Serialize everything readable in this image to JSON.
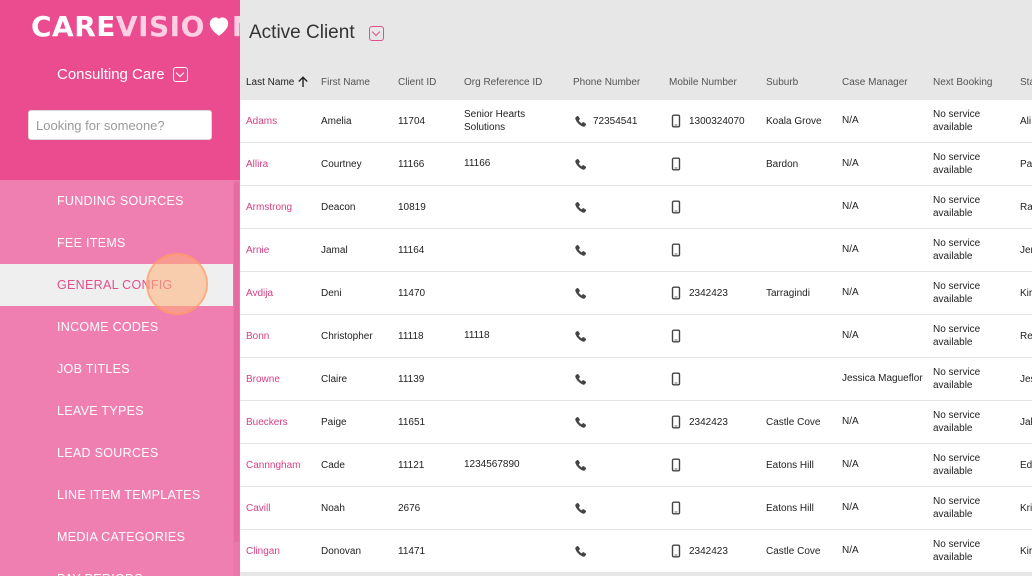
{
  "brand": {
    "care": "CARE",
    "vision": "VISIO",
    "n": "N",
    "accent": "#ea4c8f",
    "link_color": "#d63f83"
  },
  "org": {
    "name": "Consulting Care"
  },
  "search": {
    "placeholder": "Looking for someone?"
  },
  "nav": {
    "items": [
      {
        "label": "FUNDING SOURCES",
        "active": false
      },
      {
        "label": "FEE ITEMS",
        "active": false
      },
      {
        "label": "GENERAL CONFIG",
        "active": true
      },
      {
        "label": "INCOME CODES",
        "active": false
      },
      {
        "label": "JOB TITLES",
        "active": false
      },
      {
        "label": "LEAVE TYPES",
        "active": false
      },
      {
        "label": "LEAD SOURCES",
        "active": false
      },
      {
        "label": "LINE ITEM TEMPLATES",
        "active": false
      },
      {
        "label": "MEDIA CATEGORIES",
        "active": false
      },
      {
        "label": "PAY PERIODS",
        "active": false
      }
    ]
  },
  "main": {
    "title": "Active Client"
  },
  "table": {
    "columns": {
      "last": "Last Name",
      "first": "First Name",
      "id": "Client ID",
      "org": "Org Reference ID",
      "phone": "Phone Number",
      "mobile": "Mobile Number",
      "suburb": "Suburb",
      "cm": "Case Manager",
      "next": "Next Booking",
      "st": "Sta"
    },
    "rows": [
      {
        "last": "Adams",
        "first": "Amelia",
        "id": "11704",
        "org": "Senior Hearts Solutions",
        "phone": "72354541",
        "mobile": "1300324070",
        "suburb": "Koala Grove",
        "cm": "N/A",
        "next": "No service available",
        "st": "Ali"
      },
      {
        "last": "Allira",
        "first": "Courtney",
        "id": "11166",
        "org": "11166",
        "phone": "",
        "mobile": "",
        "suburb": "Bardon",
        "cm": "N/A",
        "next": "No service available",
        "st": "Pa"
      },
      {
        "last": "Armstrong",
        "first": "Deacon",
        "id": "10819",
        "org": "",
        "phone": "",
        "mobile": "",
        "suburb": "",
        "cm": "N/A",
        "next": "No service available",
        "st": "Ra"
      },
      {
        "last": "Arnie",
        "first": "Jamal",
        "id": "11164",
        "org": "",
        "phone": "",
        "mobile": "",
        "suburb": "",
        "cm": "N/A",
        "next": "No service available",
        "st": "Jer"
      },
      {
        "last": "Avdija",
        "first": "Deni",
        "id": "11470",
        "org": "",
        "phone": "",
        "mobile": "2342423",
        "suburb": "Tarragindi",
        "cm": "N/A",
        "next": "No service available",
        "st": "Kir"
      },
      {
        "last": "Bonn",
        "first": "Christopher",
        "id": "11118",
        "org": "11118",
        "phone": "",
        "mobile": "",
        "suburb": "",
        "cm": "N/A",
        "next": "No service available",
        "st": "Re"
      },
      {
        "last": "Browne",
        "first": "Claire",
        "id": "11139",
        "org": "",
        "phone": "",
        "mobile": "",
        "suburb": "",
        "cm": "Jessica Magueflor",
        "next": "No service available",
        "st": "Jes"
      },
      {
        "last": "Bueckers",
        "first": "Paige",
        "id": "11651",
        "org": "",
        "phone": "",
        "mobile": "2342423",
        "suburb": "Castle Cove",
        "cm": "N/A",
        "next": "No service available",
        "st": "Jal"
      },
      {
        "last": "Cannngham",
        "first": "Cade",
        "id": "11121",
        "org": "1234567890",
        "phone": "",
        "mobile": "",
        "suburb": "Eatons Hill",
        "cm": "N/A",
        "next": "No service available",
        "st": "Ed"
      },
      {
        "last": "Cavill",
        "first": "Noah",
        "id": "2676",
        "org": "",
        "phone": "",
        "mobile": "",
        "suburb": "Eatons Hill",
        "cm": "N/A",
        "next": "No service available",
        "st": "Kri"
      },
      {
        "last": "Clingan",
        "first": "Donovan",
        "id": "11471",
        "org": "",
        "phone": "",
        "mobile": "2342423",
        "suburb": "Castle Cove",
        "cm": "N/A",
        "next": "No service available",
        "st": "Kir"
      }
    ]
  }
}
